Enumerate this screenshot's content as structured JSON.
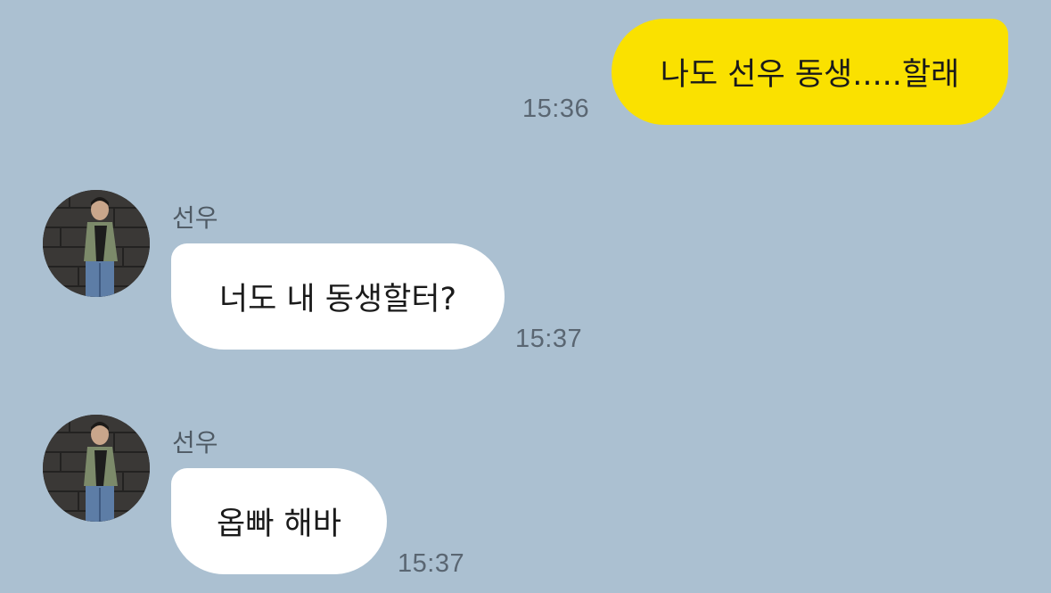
{
  "messages": [
    {
      "direction": "sent",
      "text": "나도 선우 동생.....할래",
      "time": "15:36"
    },
    {
      "direction": "received",
      "sender": "선우",
      "text": "너도 내 동생할터?",
      "time": "15:37"
    },
    {
      "direction": "received",
      "sender": "선우",
      "text": "옵빠 해바",
      "time": "15:37"
    }
  ],
  "colors": {
    "background": "#abc0d1",
    "sent_bubble": "#fae100",
    "received_bubble": "#ffffff"
  }
}
